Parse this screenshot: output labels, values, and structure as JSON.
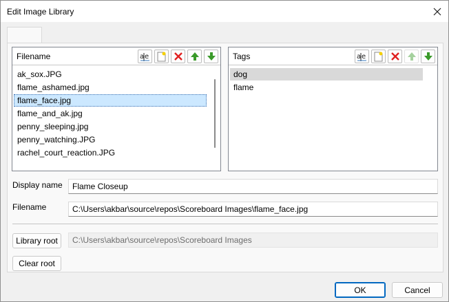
{
  "window": {
    "title": "Edit Image Library",
    "close_icon": "close-icon"
  },
  "files_pane": {
    "header": "Filename",
    "toolbar": [
      {
        "name": "spellcheck-button",
        "icon": "spellcheck-icon"
      },
      {
        "name": "new-file-button",
        "icon": "new-item-icon"
      },
      {
        "name": "delete-file-button",
        "icon": "delete-icon"
      },
      {
        "name": "move-up-file-button",
        "icon": "arrow-up-icon"
      },
      {
        "name": "move-down-file-button",
        "icon": "arrow-down-icon"
      }
    ],
    "items": [
      "ak_sox.JPG",
      "flame_ashamed.jpg",
      "flame_face.jpg",
      "flame_and_ak.jpg",
      "penny_sleeping.jpg",
      "penny_watching.JPG",
      "rachel_court_reaction.JPG"
    ],
    "selected_index": 2
  },
  "tags_pane": {
    "header": "Tags",
    "toolbar": [
      {
        "name": "spellcheck-tag-button",
        "icon": "spellcheck-icon"
      },
      {
        "name": "new-tag-button",
        "icon": "new-item-icon"
      },
      {
        "name": "delete-tag-button",
        "icon": "delete-icon"
      },
      {
        "name": "move-up-tag-button",
        "icon": "arrow-up-icon",
        "disabled": true
      },
      {
        "name": "move-down-tag-button",
        "icon": "arrow-down-icon"
      }
    ],
    "items": [
      "dog",
      "flame"
    ],
    "selected_index": 0
  },
  "form": {
    "display_name_label": "Display name",
    "display_name_value": "Flame Closeup",
    "filename_label": "Filename",
    "filename_value": "C:\\Users\\akbar\\source\\repos\\Scoreboard Images\\flame_face.jpg",
    "library_root_button": "Library root",
    "library_root_value": "C:\\Users\\akbar\\source\\repos\\Scoreboard Images",
    "clear_root_button": "Clear root"
  },
  "footer": {
    "ok_label": "OK",
    "cancel_label": "Cancel"
  },
  "colors": {
    "accent": "#0067c0",
    "selection": "#cce8ff",
    "delete_red": "#e02020",
    "arrow_green": "#3a9a2a"
  }
}
